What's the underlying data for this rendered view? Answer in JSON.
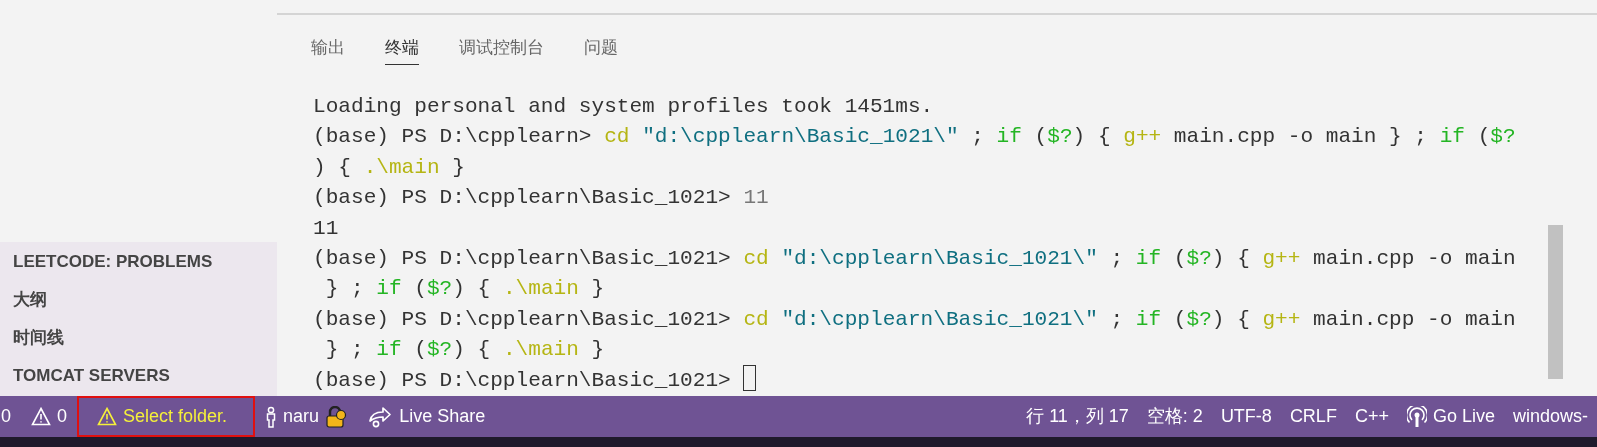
{
  "panel_tabs": [
    {
      "label": "输出",
      "selected": false
    },
    {
      "label": "终端",
      "selected": true
    },
    {
      "label": "调试控制台",
      "selected": false
    },
    {
      "label": "问题",
      "selected": false
    }
  ],
  "terminal": {
    "lines": [
      [
        {
          "kind": "plain",
          "text": "Loading personal and system profiles took 1451ms."
        }
      ],
      [
        {
          "kind": "plain",
          "text": "(base) PS D:\\cpplearn> "
        },
        {
          "kind": "command",
          "text": "cd"
        },
        {
          "kind": "string",
          "text": " \"d:\\cpplearn\\Basic_1021\\\""
        },
        {
          "kind": "plain",
          "text": " ; "
        },
        {
          "kind": "keyword",
          "text": "if"
        },
        {
          "kind": "plain",
          "text": " ("
        },
        {
          "kind": "keyword",
          "text": "$?"
        },
        {
          "kind": "plain",
          "text": ") { "
        },
        {
          "kind": "command",
          "text": "g++"
        },
        {
          "kind": "plain",
          "text": " main.cpp -o main } ; "
        },
        {
          "kind": "keyword",
          "text": "if"
        },
        {
          "kind": "plain",
          "text": " ("
        },
        {
          "kind": "keyword",
          "text": "$?"
        }
      ],
      [
        {
          "kind": "plain",
          "text": ") { "
        },
        {
          "kind": "command",
          "text": ".\\main"
        },
        {
          "kind": "plain",
          "text": " }"
        }
      ],
      [
        {
          "kind": "plain",
          "text": "(base) PS D:\\cpplearn\\Basic_1021> "
        },
        {
          "kind": "number",
          "text": "11"
        }
      ],
      [
        {
          "kind": "plain",
          "text": "11"
        }
      ],
      [
        {
          "kind": "plain",
          "text": "(base) PS D:\\cpplearn\\Basic_1021> "
        },
        {
          "kind": "command",
          "text": "cd"
        },
        {
          "kind": "string",
          "text": " \"d:\\cpplearn\\Basic_1021\\\""
        },
        {
          "kind": "plain",
          "text": " ; "
        },
        {
          "kind": "keyword",
          "text": "if"
        },
        {
          "kind": "plain",
          "text": " ("
        },
        {
          "kind": "keyword",
          "text": "$?"
        },
        {
          "kind": "plain",
          "text": ") { "
        },
        {
          "kind": "command",
          "text": "g++"
        },
        {
          "kind": "plain",
          "text": " main.cpp -o main"
        }
      ],
      [
        {
          "kind": "plain",
          "text": " } ; "
        },
        {
          "kind": "keyword",
          "text": "if"
        },
        {
          "kind": "plain",
          "text": " ("
        },
        {
          "kind": "keyword",
          "text": "$?"
        },
        {
          "kind": "plain",
          "text": ") { "
        },
        {
          "kind": "command",
          "text": ".\\main"
        },
        {
          "kind": "plain",
          "text": " }"
        }
      ],
      [
        {
          "kind": "plain",
          "text": "(base) PS D:\\cpplearn\\Basic_1021> "
        },
        {
          "kind": "command",
          "text": "cd"
        },
        {
          "kind": "string",
          "text": " \"d:\\cpplearn\\Basic_1021\\\""
        },
        {
          "kind": "plain",
          "text": " ; "
        },
        {
          "kind": "keyword",
          "text": "if"
        },
        {
          "kind": "plain",
          "text": " ("
        },
        {
          "kind": "keyword",
          "text": "$?"
        },
        {
          "kind": "plain",
          "text": ") { "
        },
        {
          "kind": "command",
          "text": "g++"
        },
        {
          "kind": "plain",
          "text": " main.cpp -o main"
        }
      ],
      [
        {
          "kind": "plain",
          "text": " } ; "
        },
        {
          "kind": "keyword",
          "text": "if"
        },
        {
          "kind": "plain",
          "text": " ("
        },
        {
          "kind": "keyword",
          "text": "$?"
        },
        {
          "kind": "plain",
          "text": ") { "
        },
        {
          "kind": "command",
          "text": ".\\main"
        },
        {
          "kind": "plain",
          "text": " }"
        }
      ],
      [
        {
          "kind": "plain",
          "text": "(base) PS D:\\cpplearn\\Basic_1021> "
        }
      ]
    ]
  },
  "sidebar": {
    "sections": [
      "LEETCODE: PROBLEMS",
      "大纲",
      "时间线",
      "TOMCAT SERVERS"
    ]
  },
  "status_bar": {
    "left": [
      {
        "kind": "errors",
        "text": "0"
      },
      {
        "kind": "warnings",
        "text": "0"
      },
      {
        "kind": "folder",
        "text": "Select folder.",
        "highlighted": true
      },
      {
        "kind": "account",
        "text": "naru"
      },
      {
        "kind": "liveshare",
        "text": "Live Share"
      }
    ],
    "right": [
      {
        "kind": "text",
        "text": "行 11，列 17"
      },
      {
        "kind": "text",
        "text": "空格: 2"
      },
      {
        "kind": "text",
        "text": "UTF-8"
      },
      {
        "kind": "text",
        "text": "CRLF"
      },
      {
        "kind": "text",
        "text": "C++"
      },
      {
        "kind": "golive",
        "text": "Go Live"
      },
      {
        "kind": "text",
        "text": "windows-"
      }
    ]
  }
}
